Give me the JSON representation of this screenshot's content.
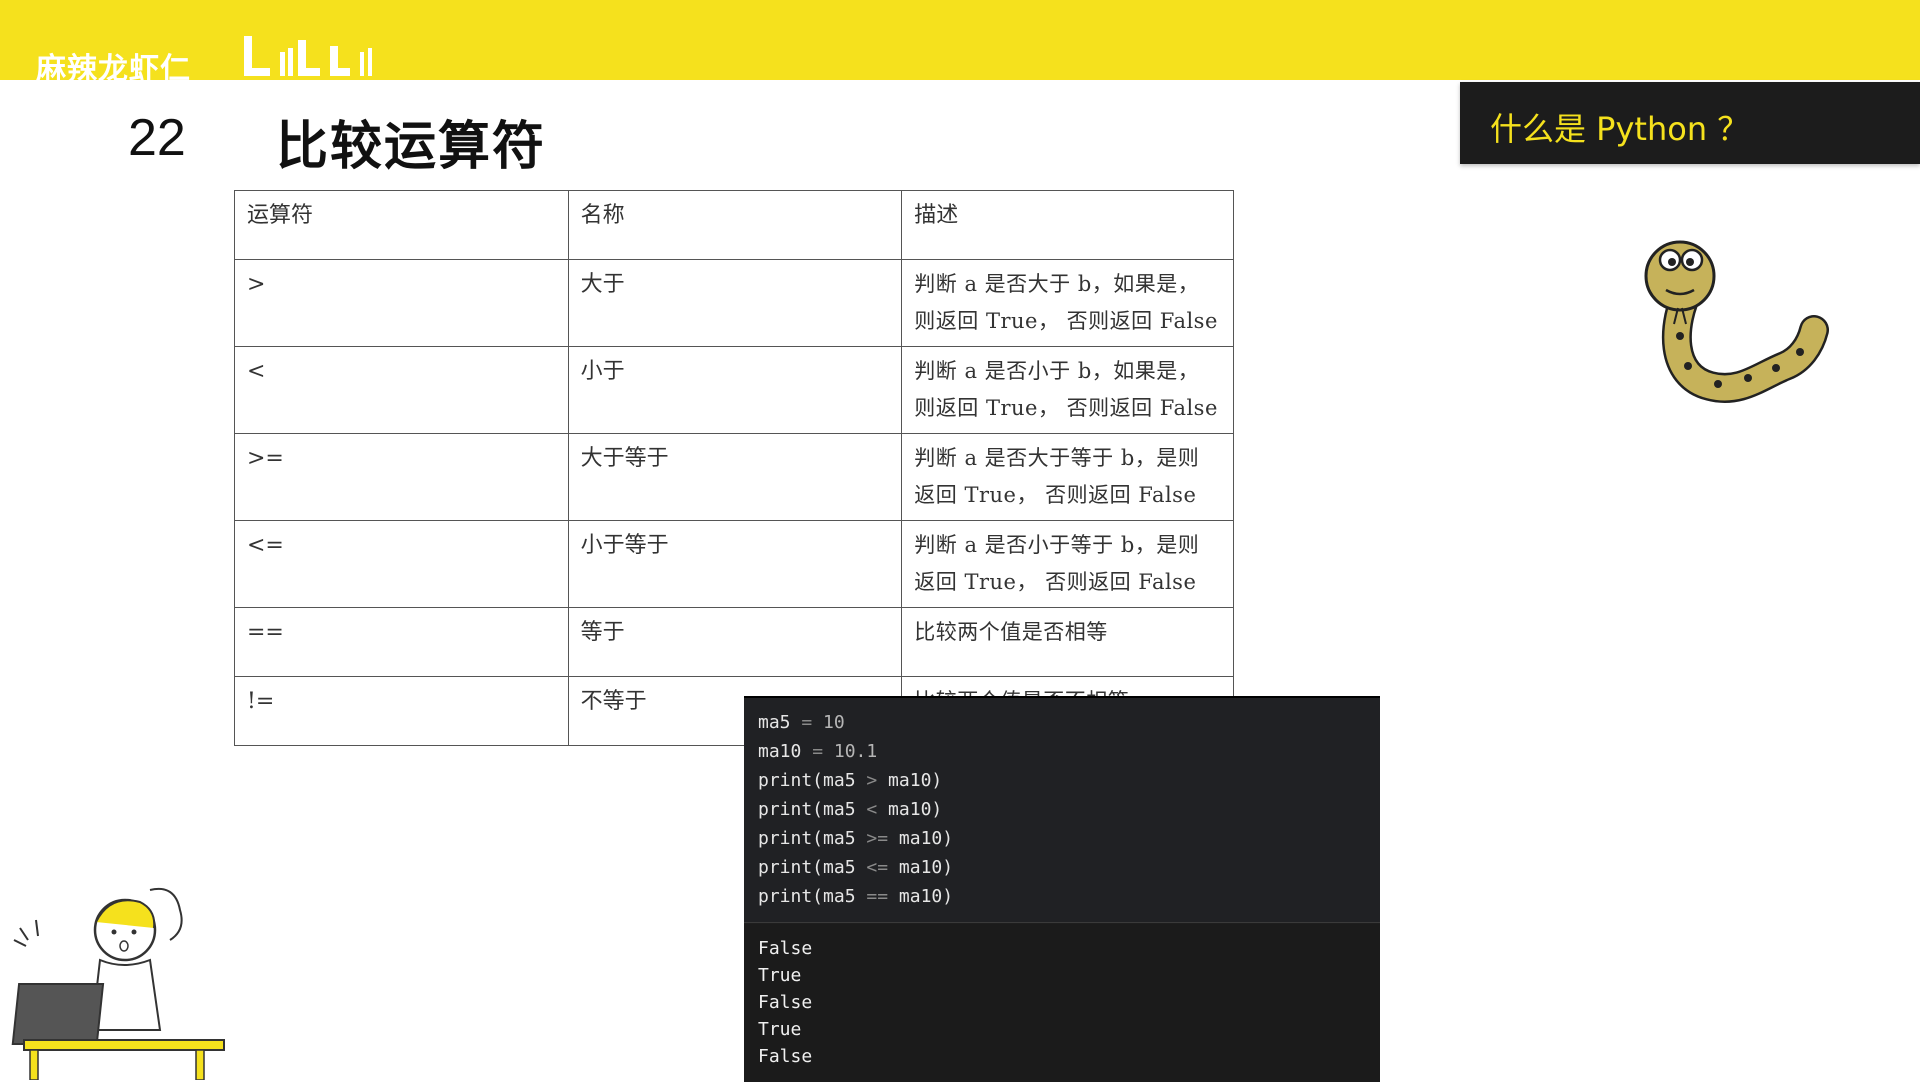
{
  "header": {
    "brand": "麻辣龙虾仁",
    "topic": "什么是 Python ？"
  },
  "slide": {
    "number": "22",
    "title": "比较运算符"
  },
  "table": {
    "headers": [
      "运算符",
      "名称",
      "描述"
    ],
    "rows": [
      {
        "op": ">",
        "name": "大于",
        "desc1": "判断 a 是否大于 b，如果是，",
        "desc2": "则返回 True， 否则返回 False"
      },
      {
        "op": "<",
        "name": "小于",
        "desc1": "判断 a 是否小于 b，如果是，",
        "desc2": "则返回 True， 否则返回 False"
      },
      {
        "op": ">=",
        "name": "大于等于",
        "desc1": "判断 a 是否大于等于 b，是则",
        "desc2": "返回 True， 否则返回 False"
      },
      {
        "op": "<=",
        "name": "小于等于",
        "desc1": "判断 a 是否小于等于 b，是则",
        "desc2": "返回 True， 否则返回 False"
      },
      {
        "op": "==",
        "name": "等于",
        "desc1": "比较两个值是否相等",
        "desc2": ""
      },
      {
        "op": "!=",
        "name": "不等于",
        "desc1": "比较两个值是否不相等",
        "desc2": ""
      }
    ]
  },
  "code": {
    "lines": [
      {
        "a": "ma5 ",
        "op": "=",
        "b": " ",
        "num": "10",
        "c": ""
      },
      {
        "a": "ma10 ",
        "op": "=",
        "b": " ",
        "num": "10.1",
        "c": ""
      },
      {
        "a": "print(ma5 ",
        "op": ">",
        "b": " ma10)",
        "num": "",
        "c": ""
      },
      {
        "a": "print(ma5 ",
        "op": "<",
        "b": " ma10)",
        "num": "",
        "c": ""
      },
      {
        "a": "print(ma5 ",
        "op": ">=",
        "b": " ma10)",
        "num": "",
        "c": ""
      },
      {
        "a": "print(ma5 ",
        "op": "<=",
        "b": " ma10)",
        "num": "",
        "c": ""
      },
      {
        "a": "print(ma5 ",
        "op": "==",
        "b": " ma10)",
        "num": "",
        "c": ""
      }
    ],
    "output": [
      "False",
      "True",
      "False",
      "True",
      "False"
    ]
  },
  "colors": {
    "banner": "#f5e11d",
    "topic_bg": "#1c1c1c",
    "topic_text": "#f5e11d",
    "code_bg": "#1e1e1e"
  },
  "icons": {
    "snake": "snake-illustration",
    "girl": "girl-at-laptop-illustration"
  }
}
